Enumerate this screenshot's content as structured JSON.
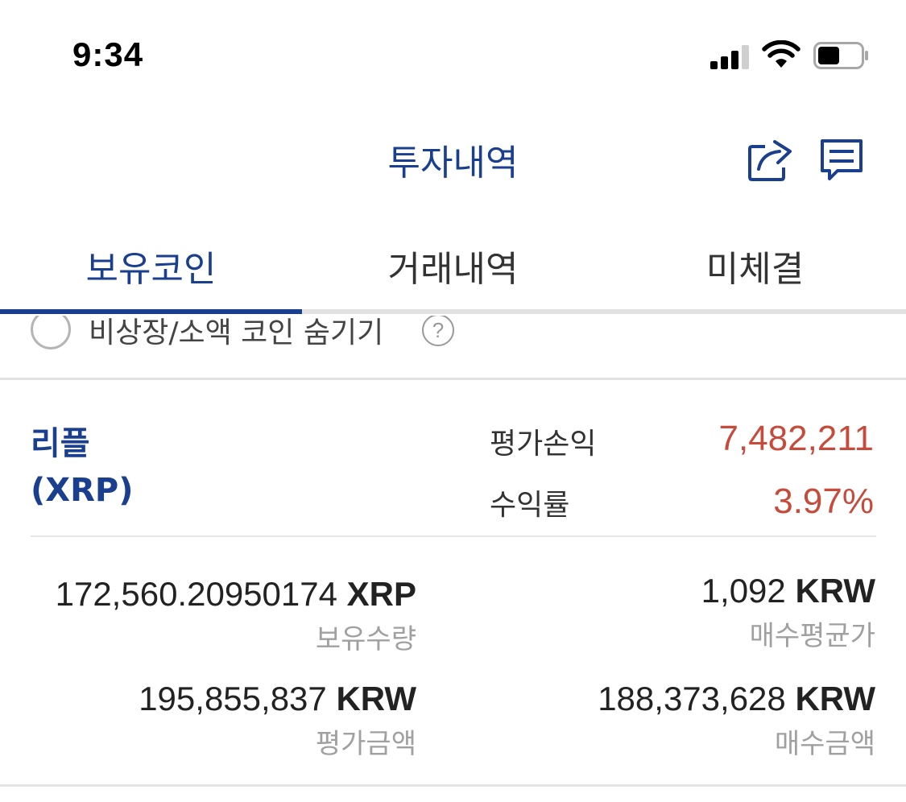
{
  "status_bar": {
    "time": "9:34"
  },
  "header": {
    "title": "투자내역",
    "icons": [
      "share-icon",
      "chat-icon"
    ],
    "accent_color": "#1b3f8f"
  },
  "tabs": [
    {
      "label": "보유코인",
      "active": true
    },
    {
      "label": "거래내역",
      "active": false
    },
    {
      "label": "미체결",
      "active": false
    }
  ],
  "filter": {
    "hide_label": "비상장/소액 코인 숨기기",
    "help_symbol": "?",
    "checked": false
  },
  "coin": {
    "name": "리플",
    "symbol": "(XRP)",
    "profit_label": "평가손익",
    "profit_value": "7,482,211",
    "return_label": "수익률",
    "return_value": "3.97%",
    "profit_color": "#c64b3b",
    "holding_amount": "172,560.20950174",
    "holding_unit": "XRP",
    "holding_label": "보유수량",
    "avg_price": "1,092",
    "avg_price_unit": "KRW",
    "avg_price_label": "매수평균가",
    "eval_amount": "195,855,837",
    "eval_unit": "KRW",
    "eval_label": "평가금액",
    "buy_amount": "188,373,628",
    "buy_unit": "KRW",
    "buy_label": "매수금액"
  }
}
